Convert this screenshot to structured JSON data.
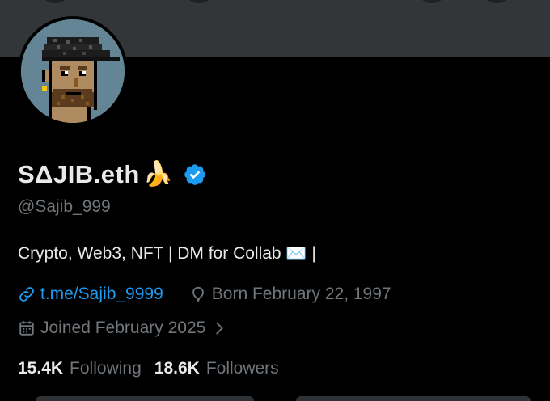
{
  "profile": {
    "display_name": "SΔJIB.eth",
    "name_emoji": "🍌",
    "handle": "@Sajib_999",
    "bio": "Crypto, Web3, NFT | DM for Collab ✉️ |",
    "link": "t.me/Sajib_9999",
    "birthday": "Born February 22, 1997",
    "joined": "Joined February 2025",
    "following_count": "15.4K",
    "following_label": "Following",
    "followers_count": "18.6K",
    "followers_label": "Followers"
  },
  "icons": {
    "verified": "verified-badge-icon",
    "link": "link-icon",
    "birthday": "balloon-icon",
    "joined": "calendar-icon",
    "joined_more": "chevron-right-icon"
  },
  "colors": {
    "background": "#000000",
    "banner": "#333639",
    "primary_text": "#e7e9ea",
    "secondary_text": "#71767b",
    "link": "#1d9bf0",
    "verified": "#1d9bf0",
    "avatar_background": "#638596"
  }
}
